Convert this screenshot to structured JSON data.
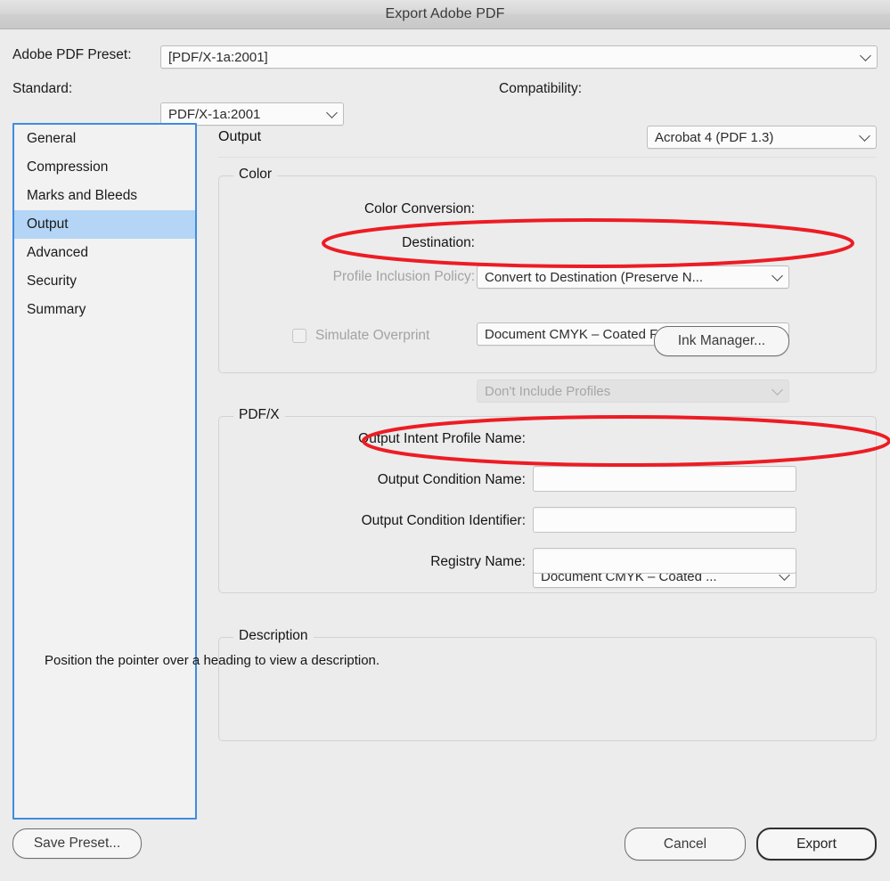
{
  "window": {
    "title": "Export Adobe PDF"
  },
  "top": {
    "preset_label": "Adobe PDF Preset:",
    "preset_value": "[PDF/X-1a:2001]",
    "standard_label": "Standard:",
    "standard_value": "PDF/X-1a:2001",
    "compatibility_label": "Compatibility:",
    "compatibility_value": "Acrobat 4 (PDF 1.3)"
  },
  "sidebar": {
    "items": [
      {
        "label": "General",
        "selected": false
      },
      {
        "label": "Compression",
        "selected": false
      },
      {
        "label": "Marks and Bleeds",
        "selected": false
      },
      {
        "label": "Output",
        "selected": true
      },
      {
        "label": "Advanced",
        "selected": false
      },
      {
        "label": "Security",
        "selected": false
      },
      {
        "label": "Summary",
        "selected": false
      }
    ]
  },
  "pane": {
    "title": "Output"
  },
  "color_group": {
    "legend": "Color",
    "color_conversion_label": "Color Conversion:",
    "color_conversion_value": "Convert to Destination (Preserve N...",
    "destination_label": "Destination:",
    "destination_value": "Document CMYK – Coated FOGRA...",
    "profile_inclusion_label": "Profile Inclusion Policy:",
    "profile_inclusion_value": "Don't Include Profiles",
    "simulate_overprint_label": "Simulate Overprint",
    "ink_manager_label": "Ink Manager..."
  },
  "pdfx_group": {
    "legend": "PDF/X",
    "output_intent_profile_label": "Output Intent Profile Name:",
    "output_intent_profile_value": "Document CMYK – Coated ...",
    "output_condition_name_label": "Output Condition Name:",
    "output_condition_name_value": "",
    "output_condition_identifier_label": "Output Condition Identifier:",
    "output_condition_identifier_value": "",
    "registry_name_label": "Registry Name:",
    "registry_name_value": ""
  },
  "description_group": {
    "legend": "Description",
    "text": "Position the pointer over a heading to view a description."
  },
  "footer": {
    "save_preset_label": "Save Preset...",
    "cancel_label": "Cancel",
    "export_label": "Export"
  },
  "annotations": {
    "color": "#ed1c24",
    "marks": [
      {
        "name": "destination-highlight"
      },
      {
        "name": "output-intent-profile-highlight"
      }
    ]
  }
}
